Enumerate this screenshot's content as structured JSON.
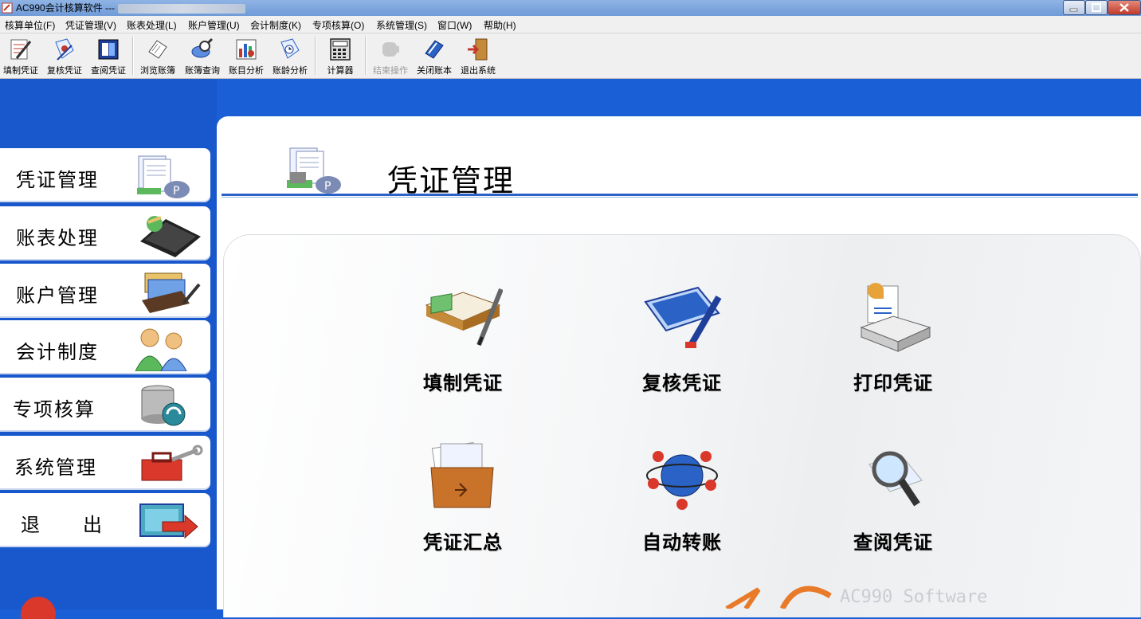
{
  "window": {
    "title": "AC990会计核算软件 ---"
  },
  "menu": [
    "核算单位(F)",
    "凭证管理(V)",
    "账表处理(L)",
    "账户管理(U)",
    "会计制度(K)",
    "专项核算(O)",
    "系统管理(S)",
    "窗口(W)",
    "帮助(H)"
  ],
  "toolbar": [
    {
      "label": "填制凭证",
      "icon": "pen-form-icon"
    },
    {
      "label": "复核凭证",
      "icon": "check-doc-icon"
    },
    {
      "label": "查阅凭证",
      "icon": "view-doc-icon"
    },
    {
      "label": "浏览账簿",
      "icon": "ledger-browse-icon"
    },
    {
      "label": "账簿查询",
      "icon": "magnifier-icon"
    },
    {
      "label": "账目分析",
      "icon": "bar-chart-icon"
    },
    {
      "label": "账龄分析",
      "icon": "clock-doc-icon"
    },
    {
      "label": "计算器",
      "icon": "calculator-icon"
    },
    {
      "label": "结束操作",
      "icon": "stop-icon",
      "disabled": true
    },
    {
      "label": "关闭账本",
      "icon": "close-book-icon"
    },
    {
      "label": "退出系统",
      "icon": "exit-door-icon"
    }
  ],
  "sidebar": [
    {
      "label": "凭证管理",
      "icon": "voucher-stack-icon"
    },
    {
      "label": "账表处理",
      "icon": "laptop-icon"
    },
    {
      "label": "账户管理",
      "icon": "account-cards-icon"
    },
    {
      "label": "会计制度",
      "icon": "users-icon"
    },
    {
      "label": "专项核算",
      "icon": "database-icon"
    },
    {
      "label": "系统管理",
      "icon": "toolbox-icon"
    },
    {
      "label": "退　　出",
      "icon": "exit-arrow-icon"
    }
  ],
  "main": {
    "title": "凭证管理",
    "tiles": [
      {
        "label": "填制凭证",
        "icon": "notebook-pen-icon"
      },
      {
        "label": "复核凭证",
        "icon": "tablet-pen-icon"
      },
      {
        "label": "打印凭证",
        "icon": "printer-icon"
      },
      {
        "label": "凭证汇总",
        "icon": "folder-icon"
      },
      {
        "label": "自动转账",
        "icon": "molecule-icon"
      },
      {
        "label": "查阅凭证",
        "icon": "search-icon"
      }
    ]
  },
  "watermark": "AC990 Software",
  "colors": {
    "accent": "#1858cc",
    "header_line": "#2a62c5"
  }
}
